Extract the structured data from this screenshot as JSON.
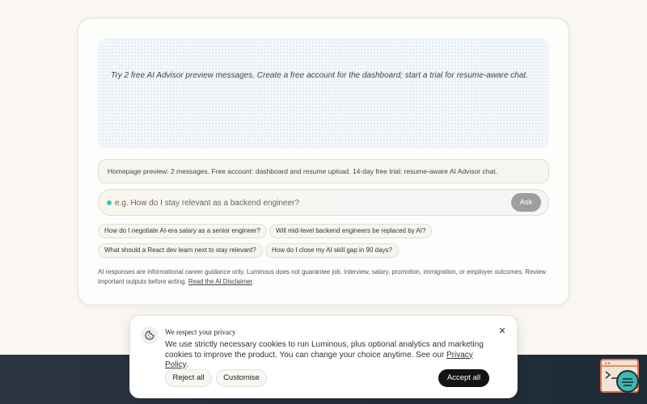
{
  "chat": {
    "intro_message": "Try 2 free AI Advisor preview messages. Create a free account for the dashboard; start a trial for resume-aware chat."
  },
  "info_bar": {
    "text": "Homepage preview: 2 messages. Free account: dashboard and resume upload. 14-day free trial: resume-aware AI Advisor chat."
  },
  "input": {
    "placeholder": "e.g. How do I stay relevant as a backend engineer?",
    "value": "",
    "ask_label": "Ask"
  },
  "suggestions": [
    "How do I negotiate AI-era salary as a senior engineer?",
    "Will mid-level backend engineers be replaced by AI?",
    "What should a React dev learn next to stay relevant?",
    "How do I close my AI skill gap in 90 days?"
  ],
  "disclaimer": {
    "text": "AI responses are informational career guidance only. Luminous does not guarantee job, interview, salary, promotion, immigration, or employer outcomes. Review important outputs before acting.",
    "link_label": "Read the AI Disclaimer",
    "suffix": "."
  },
  "cookie_banner": {
    "title": "We respect your privacy",
    "body": "We use strictly necessary cookies to run Luminous, plus optional analytics and marketing cookies to improve the product. You can change your choice anytime. See our",
    "link_label": "Privacy Policy",
    "suffix": ".",
    "reject_label": "Reject all",
    "customise_label": "Customise",
    "accept_label": "Accept all",
    "icon": "cookie-icon"
  },
  "colors": {
    "page_background": "#faf7f2",
    "footer_band": "#1f2a37",
    "status_dot": "#3fc5c0",
    "ask_button": "#9e9e9e",
    "accept_button": "#141414",
    "widget_accent": "#d9744b"
  }
}
